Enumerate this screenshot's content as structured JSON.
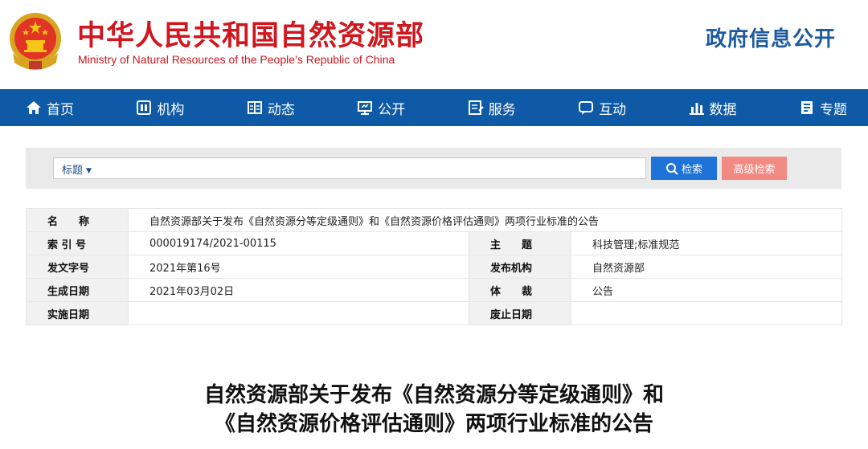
{
  "header": {
    "title_cn": "中华人民共和国自然资源部",
    "title_en": "Ministry of Natural Resources of the People’s Republic of China",
    "gov_info": "政府信息公开",
    "emblem_icon": "national-emblem-icon"
  },
  "nav": {
    "items": [
      {
        "label": "首页",
        "icon": "home-icon"
      },
      {
        "label": "机构",
        "icon": "org-icon"
      },
      {
        "label": "动态",
        "icon": "news-icon"
      },
      {
        "label": "公开",
        "icon": "monitor-icon"
      },
      {
        "label": "服务",
        "icon": "service-icon"
      },
      {
        "label": "互动",
        "icon": "chat-icon"
      },
      {
        "label": "数据",
        "icon": "bar-chart-icon"
      },
      {
        "label": "专题",
        "icon": "book-icon"
      }
    ]
  },
  "search": {
    "type_selected": "标题",
    "value": "",
    "search_label": "检索",
    "advanced_label": "高级检索"
  },
  "info": {
    "name_label": "名　　称",
    "name_value": "自然资源部关于发布《自然资源分等定级通则》和《自然资源价格评估通则》两项行业标准的公告",
    "index_label": "索 引 号",
    "index_value": "000019174/2021-00115",
    "topic_label": "主　　题",
    "topic_value": "科技管理;标准规范",
    "doc_no_label": "发文字号",
    "doc_no_value": "2021年第16号",
    "issuer_label": "发布机构",
    "issuer_value": "自然资源部",
    "created_label": "生成日期",
    "created_value": "2021年03月02日",
    "genre_label": "体　　裁",
    "genre_value": "公告",
    "effective_label": "实施日期",
    "effective_value": "",
    "abolish_label": "废止日期",
    "abolish_value": ""
  },
  "article": {
    "title_line1": "自然资源部关于发布《自然资源分等定级通则》和",
    "title_line2": "《自然资源价格评估通则》两项行业标准的公告"
  },
  "colors": {
    "brand_red": "#d0161e",
    "nav_blue": "#0e5aa6",
    "search_blue": "#1e73d8",
    "advanced_pink": "#f08a82",
    "gov_info_blue": "#1e5a9c"
  }
}
